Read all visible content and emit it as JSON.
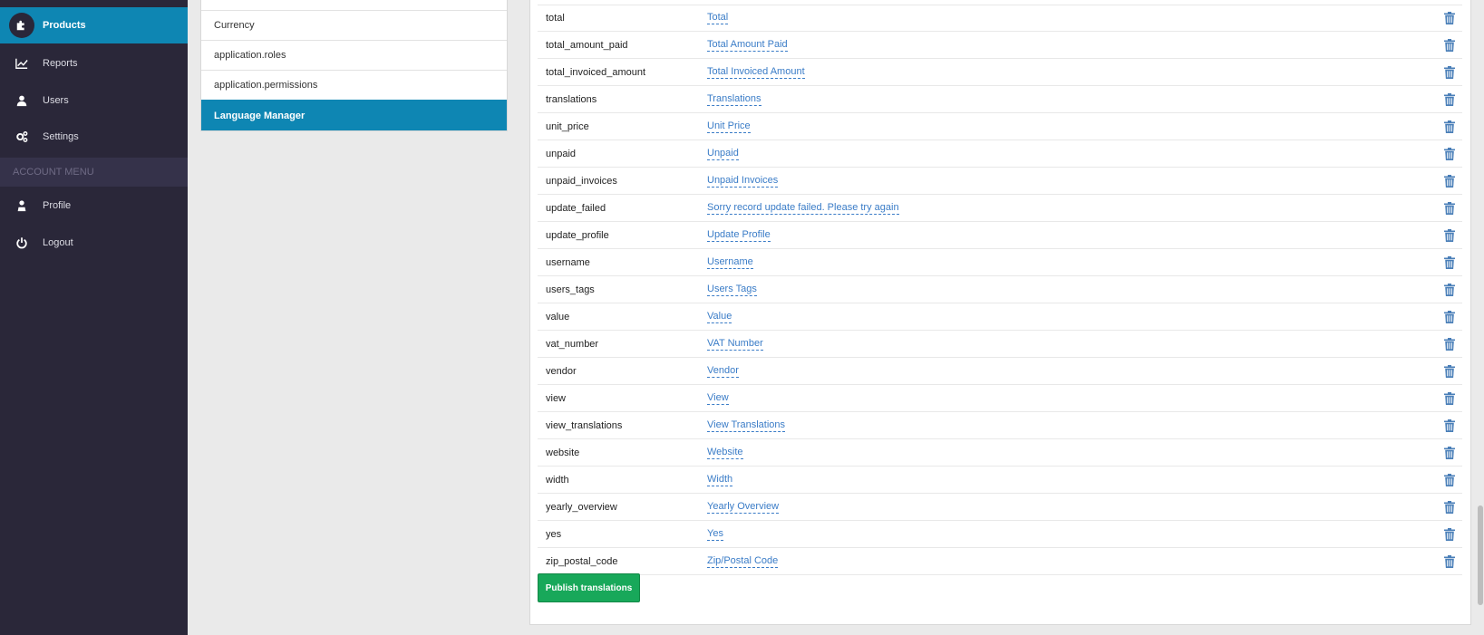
{
  "sidebar": {
    "items": [
      {
        "label": "Products",
        "icon": "puzzle-icon",
        "active": true
      },
      {
        "label": "Reports",
        "icon": "chart-line-icon"
      },
      {
        "label": "Users",
        "icon": "user-icon"
      },
      {
        "label": "Settings",
        "icon": "gears-icon"
      }
    ],
    "account_header": "ACCOUNT MENU",
    "account_items": [
      {
        "label": "Profile",
        "icon": "profile-icon"
      },
      {
        "label": "Logout",
        "icon": "power-icon"
      }
    ]
  },
  "groups": {
    "items": [
      "Currency",
      "application.roles",
      "application.permissions",
      "Language Manager"
    ],
    "active": "Language Manager"
  },
  "translations": [
    {
      "key": "total",
      "value": "Total"
    },
    {
      "key": "total_amount_paid",
      "value": "Total Amount Paid"
    },
    {
      "key": "total_invoiced_amount",
      "value": "Total Invoiced Amount"
    },
    {
      "key": "translations",
      "value": "Translations"
    },
    {
      "key": "unit_price",
      "value": "Unit Price"
    },
    {
      "key": "unpaid",
      "value": "Unpaid"
    },
    {
      "key": "unpaid_invoices",
      "value": "Unpaid Invoices"
    },
    {
      "key": "update_failed",
      "value": "Sorry record update failed. Please try again"
    },
    {
      "key": "update_profile",
      "value": "Update Profile"
    },
    {
      "key": "username",
      "value": "Username"
    },
    {
      "key": "users_tags",
      "value": "Users Tags"
    },
    {
      "key": "value",
      "value": "Value"
    },
    {
      "key": "vat_number",
      "value": "VAT Number"
    },
    {
      "key": "vendor",
      "value": "Vendor"
    },
    {
      "key": "view",
      "value": "View"
    },
    {
      "key": "view_translations",
      "value": "View Translations"
    },
    {
      "key": "website",
      "value": "Website"
    },
    {
      "key": "width",
      "value": "Width"
    },
    {
      "key": "yearly_overview",
      "value": "Yearly Overview"
    },
    {
      "key": "yes",
      "value": "Yes"
    },
    {
      "key": "zip_postal_code",
      "value": "Zip/Postal Code"
    }
  ],
  "publish_label": "Publish translations",
  "colors": {
    "sidebar_bg": "#2a2739",
    "accent": "#0e86b3",
    "link": "#3a7cc7",
    "publish": "#18a85a"
  }
}
